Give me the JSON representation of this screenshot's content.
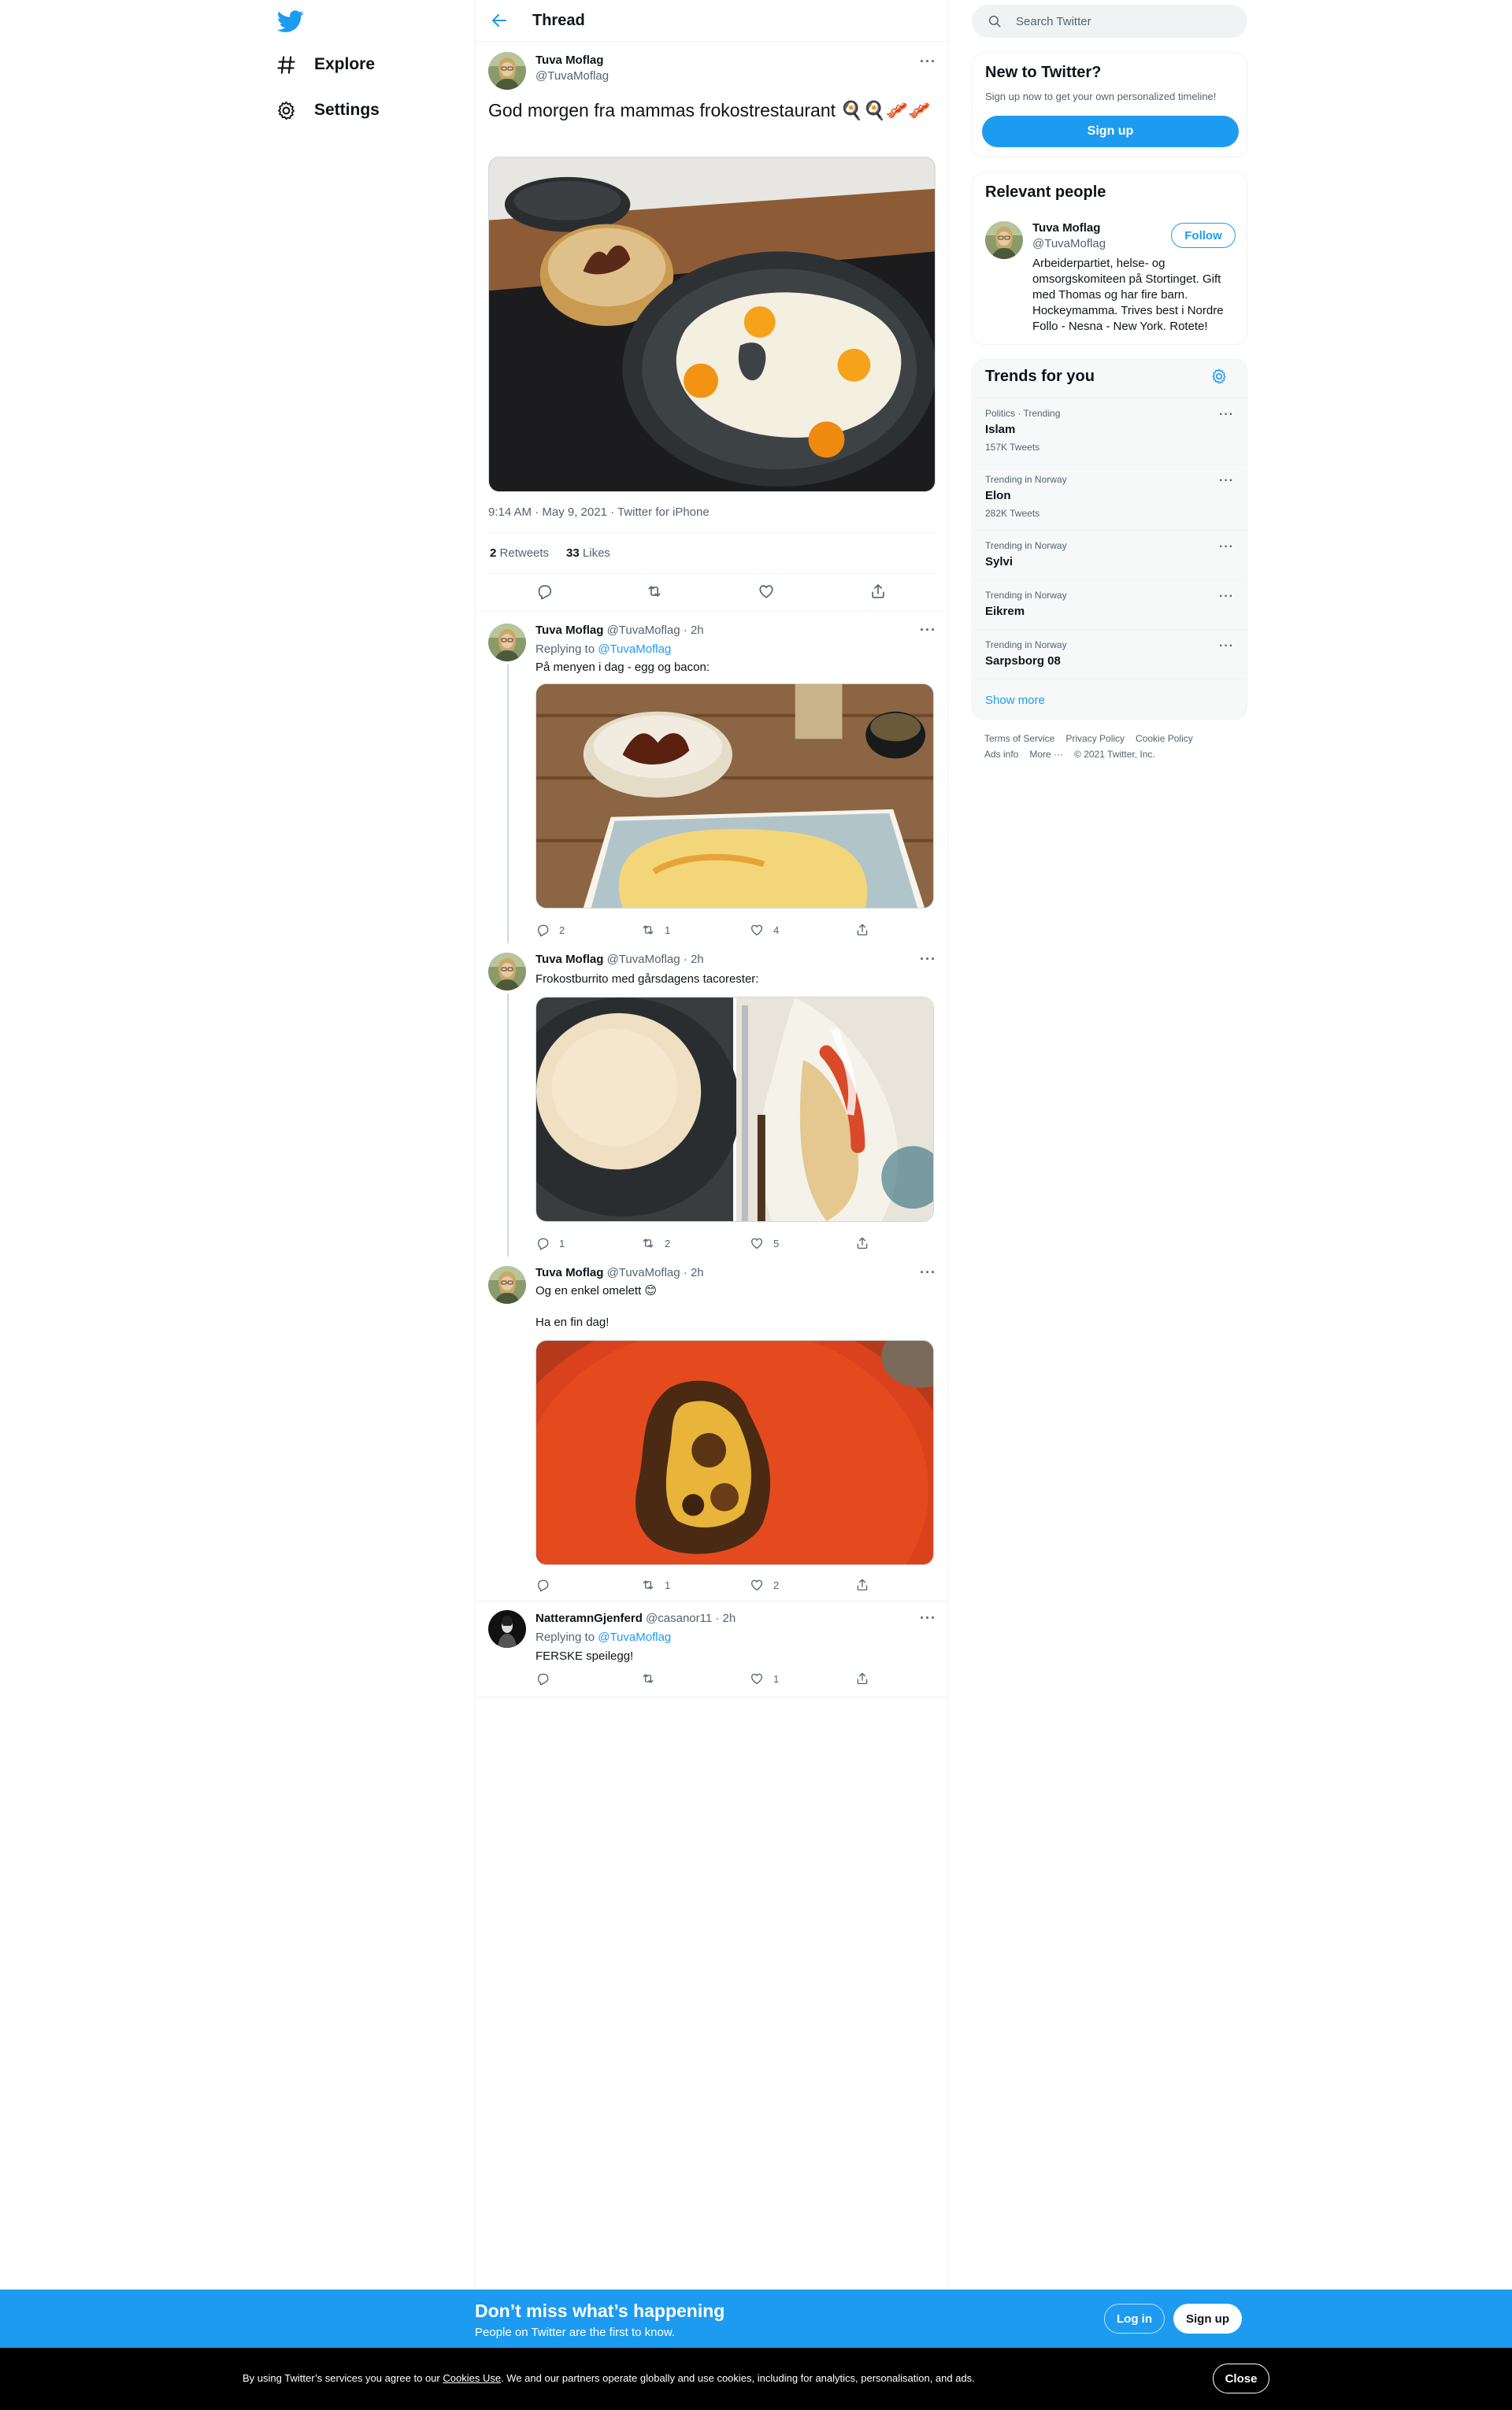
{
  "nav": {
    "logo": "twitter-bird-icon",
    "items": [
      {
        "label": "Explore",
        "icon": "hashtag-icon"
      },
      {
        "label": "Settings",
        "icon": "gear-icon"
      }
    ]
  },
  "header": {
    "title": "Thread"
  },
  "main_tweet": {
    "name": "Tuva Moflag",
    "handle": "@TuvaMoflag",
    "text": "God morgen fra mammas frokostrestaurant 🍳🍳🥓🥓",
    "meta": "9:14 AM · May 9, 2021 · Twitter for iPhone",
    "retweets_count": "2",
    "retweets_label": "Retweets",
    "likes_count": "33",
    "likes_label": "Likes"
  },
  "replies": [
    {
      "name": "Tuva Moflag",
      "handle": "@TuvaMoflag",
      "time": "· 2h",
      "replying_prefix": "Replying to",
      "replying_to": "@TuvaMoflag",
      "text": "På menyen i dag - egg og bacon:",
      "replies": "2",
      "retweets": "1",
      "likes": "4"
    },
    {
      "name": "Tuva Moflag",
      "handle": "@TuvaMoflag",
      "time": "· 2h",
      "text": "Frokostburrito med gårsdagens tacorester:",
      "replies": "1",
      "retweets": "2",
      "likes": "5"
    },
    {
      "name": "Tuva Moflag",
      "handle": "@TuvaMoflag",
      "time": "· 2h",
      "text": "Og en enkel omelett 😊",
      "text2": "Ha en fin dag!",
      "replies": "",
      "retweets": "1",
      "likes": "2"
    },
    {
      "name": "NatteramnGjenferd",
      "handle": "@casanor11",
      "time": "· 2h",
      "replying_prefix": "Replying to",
      "replying_to": "@TuvaMoflag",
      "text": "FERSKE speilegg!",
      "replies": "",
      "retweets": "",
      "likes": "1"
    }
  ],
  "sidebar": {
    "search_placeholder": "Search Twitter",
    "new_title": "New to Twitter?",
    "new_sub": "Sign up now to get your own personalized timeline!",
    "signup_label": "Sign up",
    "relevant_title": "Relevant people",
    "person": {
      "name": "Tuva Moflag",
      "handle": "@TuvaMoflag",
      "follow_label": "Follow",
      "bio": "Arbeiderpartiet, helse- og omsorgskomiteen på Stortinget. Gift med Thomas og har fire barn. Hockeymamma. Trives best i Nordre Follo - Nesna - New York. Rotete!"
    },
    "trends_title": "Trends for you",
    "trends": [
      {
        "context": "Politics · Trending",
        "name": "Islam",
        "count": "157K Tweets"
      },
      {
        "context": "Trending in Norway",
        "name": "Elon",
        "count": "282K Tweets"
      },
      {
        "context": "Trending in Norway",
        "name": "Sylvi",
        "count": ""
      },
      {
        "context": "Trending in Norway",
        "name": "Eikrem",
        "count": ""
      },
      {
        "context": "Trending in Norway",
        "name": "Sarpsborg 08",
        "count": ""
      }
    ],
    "show_more": "Show more",
    "footer": [
      "Terms of Service",
      "Privacy Policy",
      "Cookie Policy",
      "Ads info",
      "More ···",
      "© 2021 Twitter, Inc."
    ]
  },
  "banner": {
    "title": "Don’t miss what’s happening",
    "sub": "People on Twitter are the first to know.",
    "login": "Log in",
    "signup": "Sign up"
  },
  "cookie": {
    "prefix": "By using Twitter’s services you agree to our",
    "link": "Cookies Use",
    "suffix": ". We and our partners operate globally and use cookies, including for analytics, personalisation, and ads.",
    "close": "Close"
  },
  "colors": {
    "accent": "#1d9bf0",
    "text": "#0f1419",
    "secondary": "#536471",
    "cookie_bg": "#000000"
  }
}
